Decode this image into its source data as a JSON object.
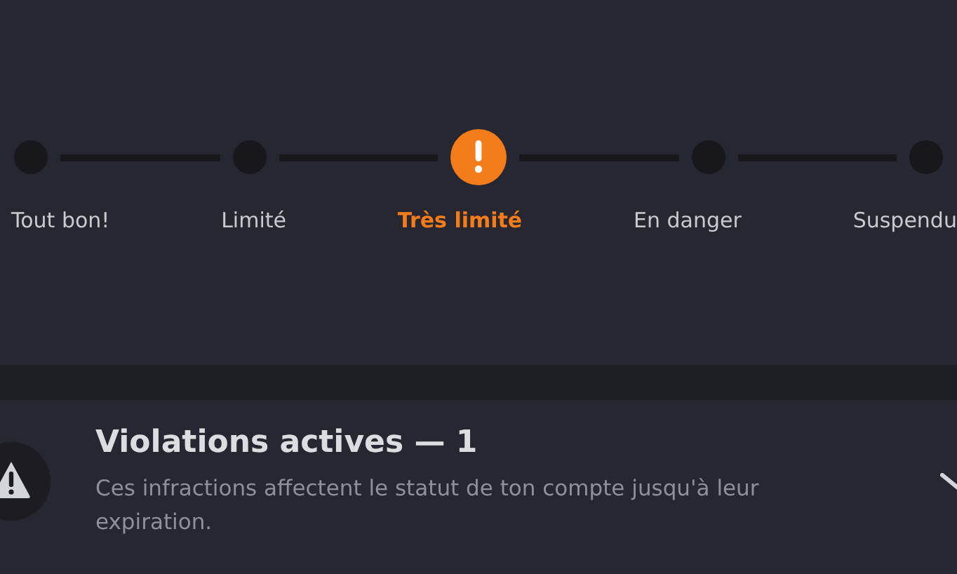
{
  "steps": [
    {
      "label": "Tout bon!",
      "selected": false
    },
    {
      "label": "Limité",
      "selected": false
    },
    {
      "label": "Très limité",
      "selected": true
    },
    {
      "label": "En danger",
      "selected": false
    },
    {
      "label": "Suspendu",
      "selected": false
    }
  ],
  "violations": {
    "title": "Violations actives — 1",
    "description": "Ces infractions affectent le statut de ton compte jusqu'à leur expiration."
  }
}
